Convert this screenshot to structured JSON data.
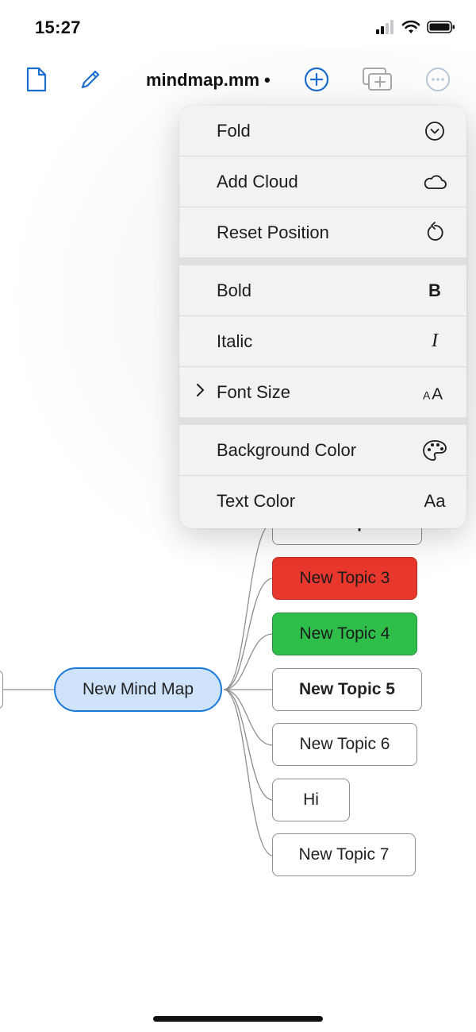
{
  "status": {
    "time": "15:27"
  },
  "toolbar": {
    "title": "mindmap.mm",
    "edited_dot": "•",
    "icons": [
      "document-icon",
      "pencil-icon",
      "add-circle-icon",
      "add-window-icon",
      "more-icon"
    ],
    "accent": "#1b6fd0"
  },
  "menu": {
    "groups": [
      [
        {
          "label": "Fold",
          "icon": "chevron-down-circle-icon"
        },
        {
          "label": "Add Cloud",
          "icon": "cloud-icon"
        },
        {
          "label": "Reset Position",
          "icon": "rotate-left-icon"
        }
      ],
      [
        {
          "label": "Bold",
          "icon": "bold-icon",
          "glyph": "B"
        },
        {
          "label": "Italic",
          "icon": "italic-icon",
          "glyph": "I"
        },
        {
          "label": "Font Size",
          "icon": "font-size-icon",
          "glyph": "AA",
          "has_submenu": true
        }
      ],
      [
        {
          "label": "Background Color",
          "icon": "palette-icon"
        },
        {
          "label": "Text Color",
          "icon": "text-color-icon",
          "glyph": "Aa"
        }
      ]
    ]
  },
  "mindmap": {
    "root": {
      "label": "New Mind Map",
      "fill": "#cfe3fb",
      "border": "#1b7ad8"
    },
    "topics": [
      {
        "label": "New Topic 2",
        "style": "bold",
        "partially_hidden": true
      },
      {
        "label": "New Topic 3",
        "style": "red",
        "color": "#e8372c"
      },
      {
        "label": "New Topic 4",
        "style": "green",
        "color": "#2fbe4a"
      },
      {
        "label": "New Topic 5",
        "style": "bold"
      },
      {
        "label": "New Topic 6",
        "style": "normal"
      },
      {
        "label": "Hi",
        "style": "normal"
      },
      {
        "label": "New Topic 7",
        "style": "normal"
      }
    ]
  }
}
